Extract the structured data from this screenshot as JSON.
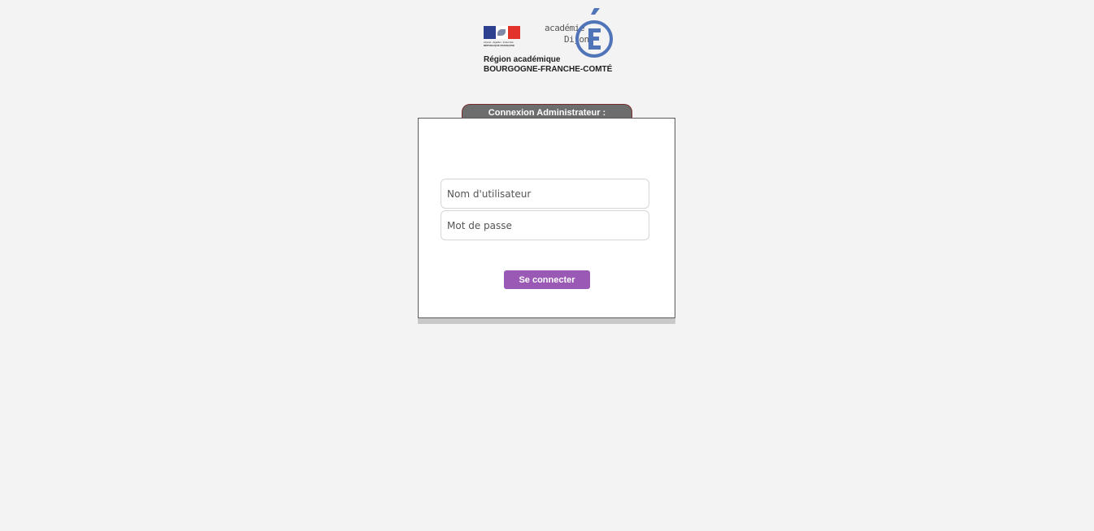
{
  "logo": {
    "motto": "Liberté • Égalité • Fraternité",
    "republique": "RÉPUBLIQUE FRANÇAISE",
    "academie": "académie",
    "city": "Dijon",
    "region_line1": "Région académique",
    "region_line2": "BOURGOGNE-FRANCHE-COMTÉ",
    "icons": [
      "marianne-flag-icon",
      "academie-e-icon"
    ],
    "colors": {
      "flag_blue": "#2d3f8f",
      "flag_red": "#e3322b",
      "e_blue": "#4f74b8"
    }
  },
  "login": {
    "title": "Connexion Administrateur :",
    "username_placeholder": "Nom d'utilisateur",
    "password_placeholder": "Mot de passe",
    "submit_label": "Se connecter",
    "colors": {
      "tab_bg": "#6d6d6d",
      "button_bg": "#9b59b6"
    }
  }
}
